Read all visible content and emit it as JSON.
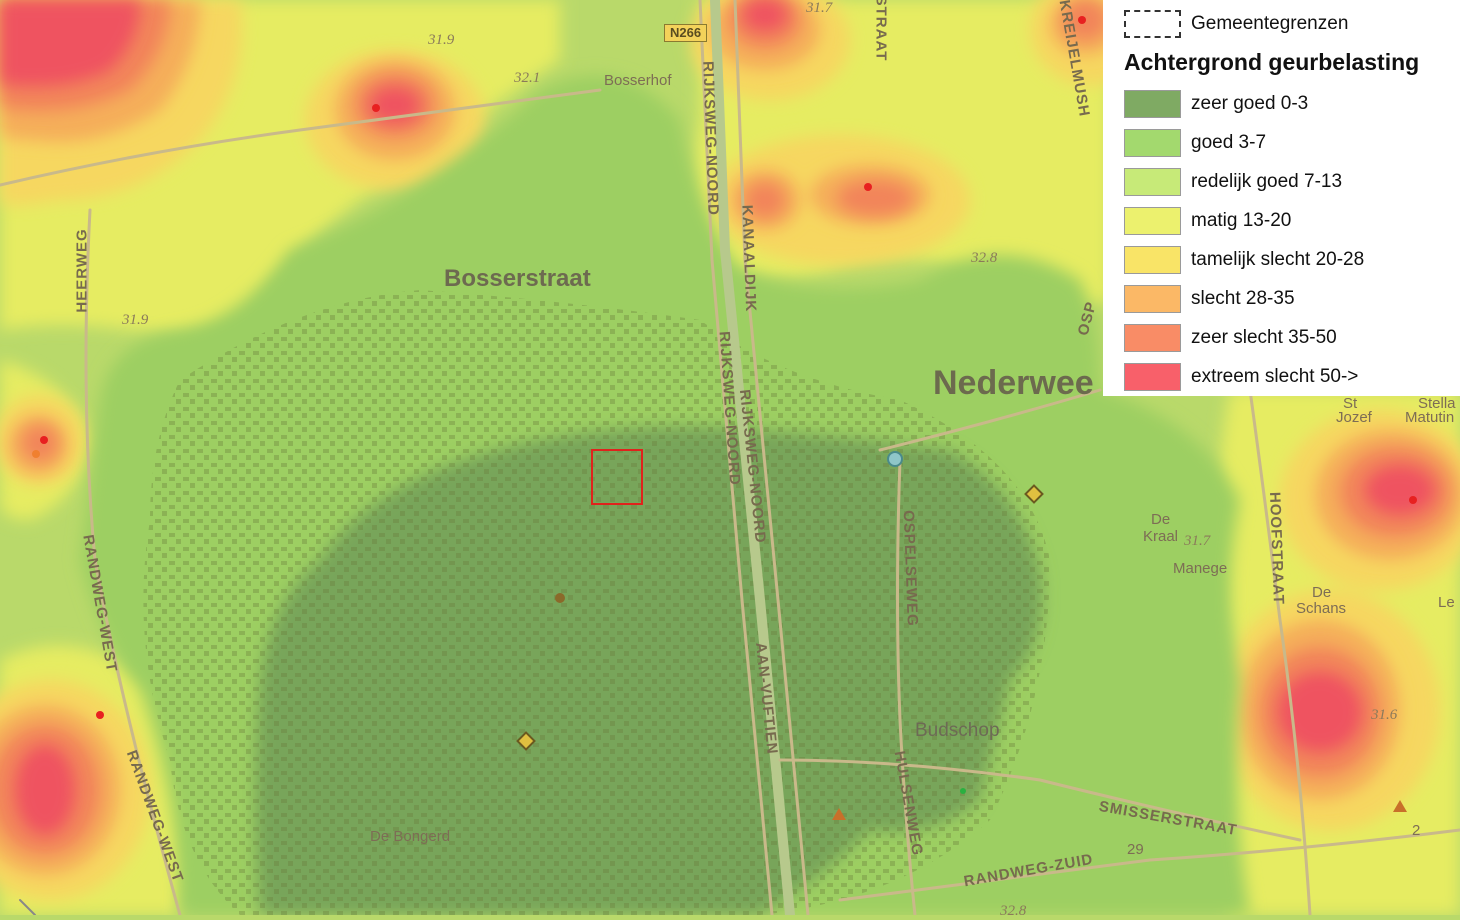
{
  "legend": {
    "boundary_label": "Gemeentegrenzen",
    "title": "Achtergrond geurbelasting",
    "classes": [
      {
        "label": "zeer goed 0-3",
        "color": "#7faa63"
      },
      {
        "label": "goed 3-7",
        "color": "#a3d96e"
      },
      {
        "label": "redelijk goed 7-13",
        "color": "#c7ea78"
      },
      {
        "label": "matig 13-20",
        "color": "#ecf16e"
      },
      {
        "label": "tamelijk slecht 20-28",
        "color": "#f9e467"
      },
      {
        "label": "slecht 28-35",
        "color": "#fbb866"
      },
      {
        "label": "zeer slecht 35-50",
        "color": "#f98c66"
      },
      {
        "label": "extreem slecht 50->",
        "color": "#f8606a"
      }
    ]
  },
  "map": {
    "places": {
      "bosserstraat": "Bosserstraat",
      "nederweert": "Nederwee",
      "budschop": "Budschop",
      "de_bongerd": "De Bongerd",
      "bosserhof": "Bosserhof",
      "de_kraal_1": "De",
      "de_kraal_2": "Kraal",
      "manege": "Manege",
      "de_schans_1": "De",
      "de_schans_2": "Schans",
      "st_jozef_1": "St",
      "st_jozef_2": "Jozef",
      "stella_1": "Stella",
      "stella_2": "Matutin",
      "le": "Le"
    },
    "roads": {
      "n266": "N266",
      "rijksweg_noord_1": "RIJKSWEG-NOORD",
      "rijksweg_noord_2": "RIJKSWEG-NOORD",
      "rijksweg_noord_3": "RIJKSWEG-NOORD",
      "kanaaldijk": "KANAALDIJK",
      "aan_vuftien": "AAN-VUFTIEN",
      "heerweg": "HEERWEG",
      "randweg_west_1": "RANDWEG-WEST",
      "randweg_west_2": "RANDWEG-WEST",
      "ospelseweg": "OSPELSEWEG",
      "ospelseweg_short": "OSP",
      "hulsenweg": "HULSENWEG",
      "hoofstraat": "HOOFSTRAAT",
      "smisserstraat": "SMISSERSTRAAT",
      "randweg_zuid": "RANDWEG-ZUID",
      "kreijel": "KREIJELMUSH",
      "straat_top": "STRAAT"
    },
    "heights": {
      "h1": "31.9",
      "h2": "32.1",
      "h3": "31.9",
      "h4": "31.7",
      "h5": "32.8",
      "h6": "31.7",
      "h7": "31.6",
      "h8": "32.8",
      "n29": "29",
      "n2": "2"
    }
  }
}
